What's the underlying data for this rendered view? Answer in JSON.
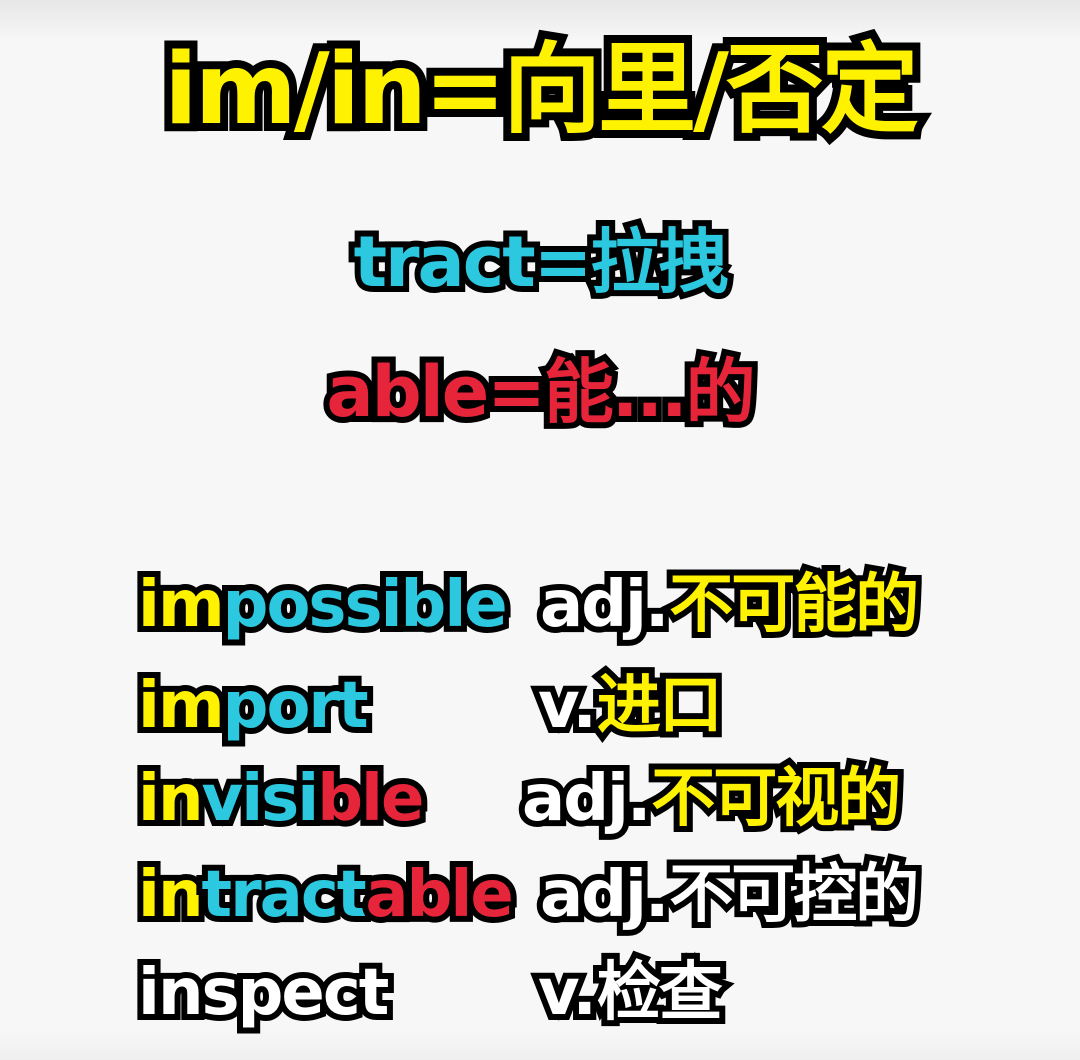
{
  "colors": {
    "yellow": "#fff200",
    "cyan": "#2cc8df",
    "red": "#e6243a",
    "white": "#ffffff",
    "outline": "#000000"
  },
  "title": {
    "prefix": "im/in",
    "rest": "=向里/否定"
  },
  "root": {
    "text": "tract=拉拽"
  },
  "suffix": {
    "text": "able=能...的"
  },
  "words": [
    {
      "word_parts": [
        {
          "text": "im",
          "color": "yellow"
        },
        {
          "text": "possible",
          "color": "cyan"
        }
      ],
      "pos": "adj.",
      "meaning": "不可能的",
      "meaning_color": "yellow"
    },
    {
      "word_parts": [
        {
          "text": "im",
          "color": "yellow"
        },
        {
          "text": "port",
          "color": "cyan"
        }
      ],
      "pos": "v.",
      "meaning": "进口",
      "meaning_color": "yellow"
    },
    {
      "word_parts": [
        {
          "text": "in",
          "color": "yellow"
        },
        {
          "text": "visi",
          "color": "cyan"
        },
        {
          "text": "ble",
          "color": "red"
        }
      ],
      "pos": "adj.",
      "meaning": "不可视的",
      "meaning_color": "yellow"
    },
    {
      "word_parts": [
        {
          "text": "in",
          "color": "yellow"
        },
        {
          "text": "tract",
          "color": "cyan"
        },
        {
          "text": "able",
          "color": "red"
        }
      ],
      "pos": "adj.",
      "meaning": "不可控的",
      "meaning_color": "white"
    },
    {
      "word_parts": [
        {
          "text": "inspect",
          "color": "white"
        }
      ],
      "pos": "v.",
      "meaning": "检查",
      "meaning_color": "white"
    }
  ]
}
